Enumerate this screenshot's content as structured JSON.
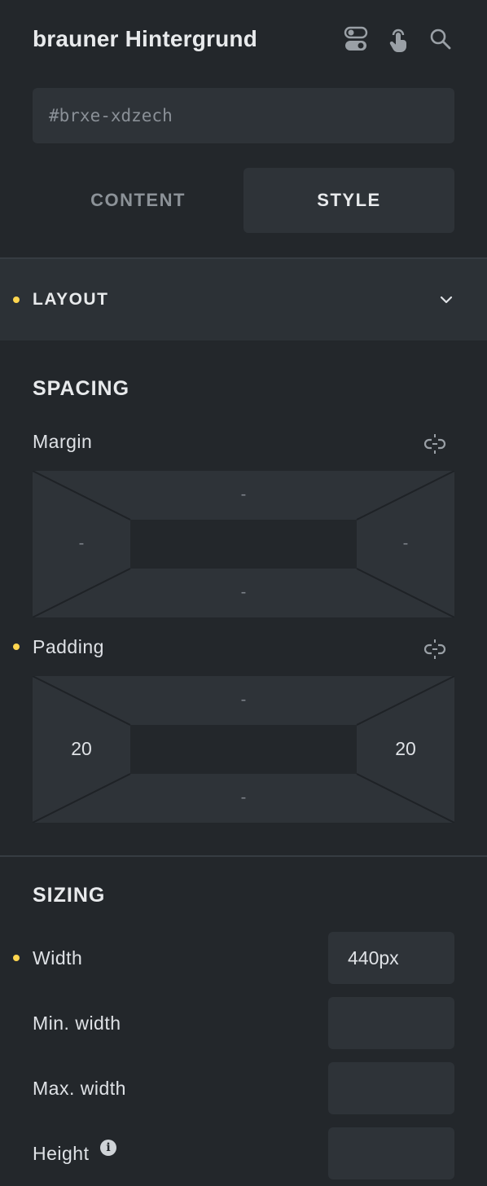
{
  "header": {
    "title": "brauner Hintergrund",
    "icons": [
      "toggle-icon",
      "touch-pointer-icon",
      "search-icon"
    ]
  },
  "element_id": {
    "value": "#brxe-xdzech"
  },
  "tabs": [
    {
      "label": "CONTENT",
      "active": false
    },
    {
      "label": "STYLE",
      "active": true
    }
  ],
  "layout_section": {
    "title": "LAYOUT",
    "modified": true
  },
  "spacing": {
    "title": "SPACING",
    "margin": {
      "label": "Margin",
      "top": "-",
      "right": "-",
      "bottom": "-",
      "left": "-",
      "modified": false
    },
    "padding": {
      "label": "Padding",
      "top": "-",
      "right": "20",
      "bottom": "-",
      "left": "20",
      "modified": true
    }
  },
  "sizing": {
    "title": "SIZING",
    "width": {
      "label": "Width",
      "value": "440px",
      "modified": true
    },
    "min_width": {
      "label": "Min. width",
      "value": ""
    },
    "max_width": {
      "label": "Max. width",
      "value": ""
    },
    "height": {
      "label": "Height",
      "value": "",
      "info_icon": "i"
    }
  },
  "colors": {
    "accent_dot": "#ffd64f",
    "panel_bg": "#23272b",
    "field_bg": "#2e3338"
  }
}
